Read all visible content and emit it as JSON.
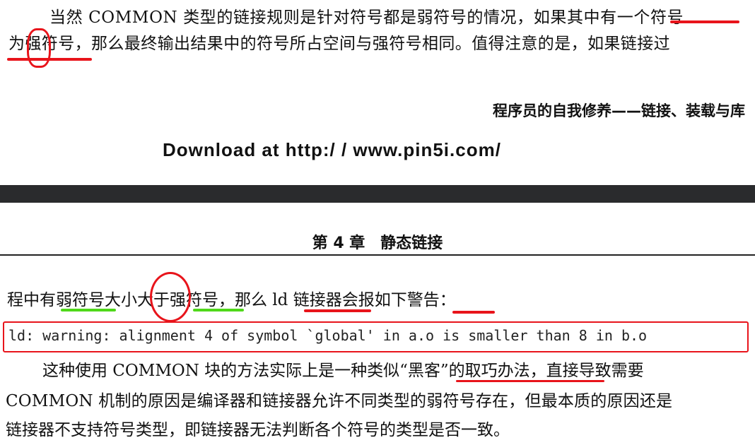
{
  "page_top": {
    "line1": "当然 COMMON 类型的链接规则是针对符号都是弱符号的情况，如果其中有一个符号",
    "line2": "为强符号，那么最终输出结果中的符号所占空间与强符号相同。值得注意的是，如果链接过",
    "running_header": "程序员的自我修养——链接、装载与库",
    "download_note": "Download at http:/ / www.pin5i.com/"
  },
  "page_bottom": {
    "chapter_header": "第 4 章　静态链接",
    "line1": "程中有弱符号大小大于强符号，那么 ld 链接器会报如下警告：",
    "code": "ld: warning: alignment 4 of symbol `global' in a.o is smaller than 8 in b.o",
    "para_line1": "这种使用 COMMON 块的方法实际上是一种类似“黑客”的取巧办法，直接导致需要",
    "para_line2": "COMMON 机制的原因是编译器和链接器允许不同类型的弱符号存在，但最本质的原因还是",
    "para_line3": "链接器不支持符号类型，即链接器无法判断各个符号的类型是否一致。"
  },
  "colors": {
    "annotation_red": "#e8141b",
    "annotation_green": "#4fd81a",
    "divider_band": "#2a2b2d"
  }
}
